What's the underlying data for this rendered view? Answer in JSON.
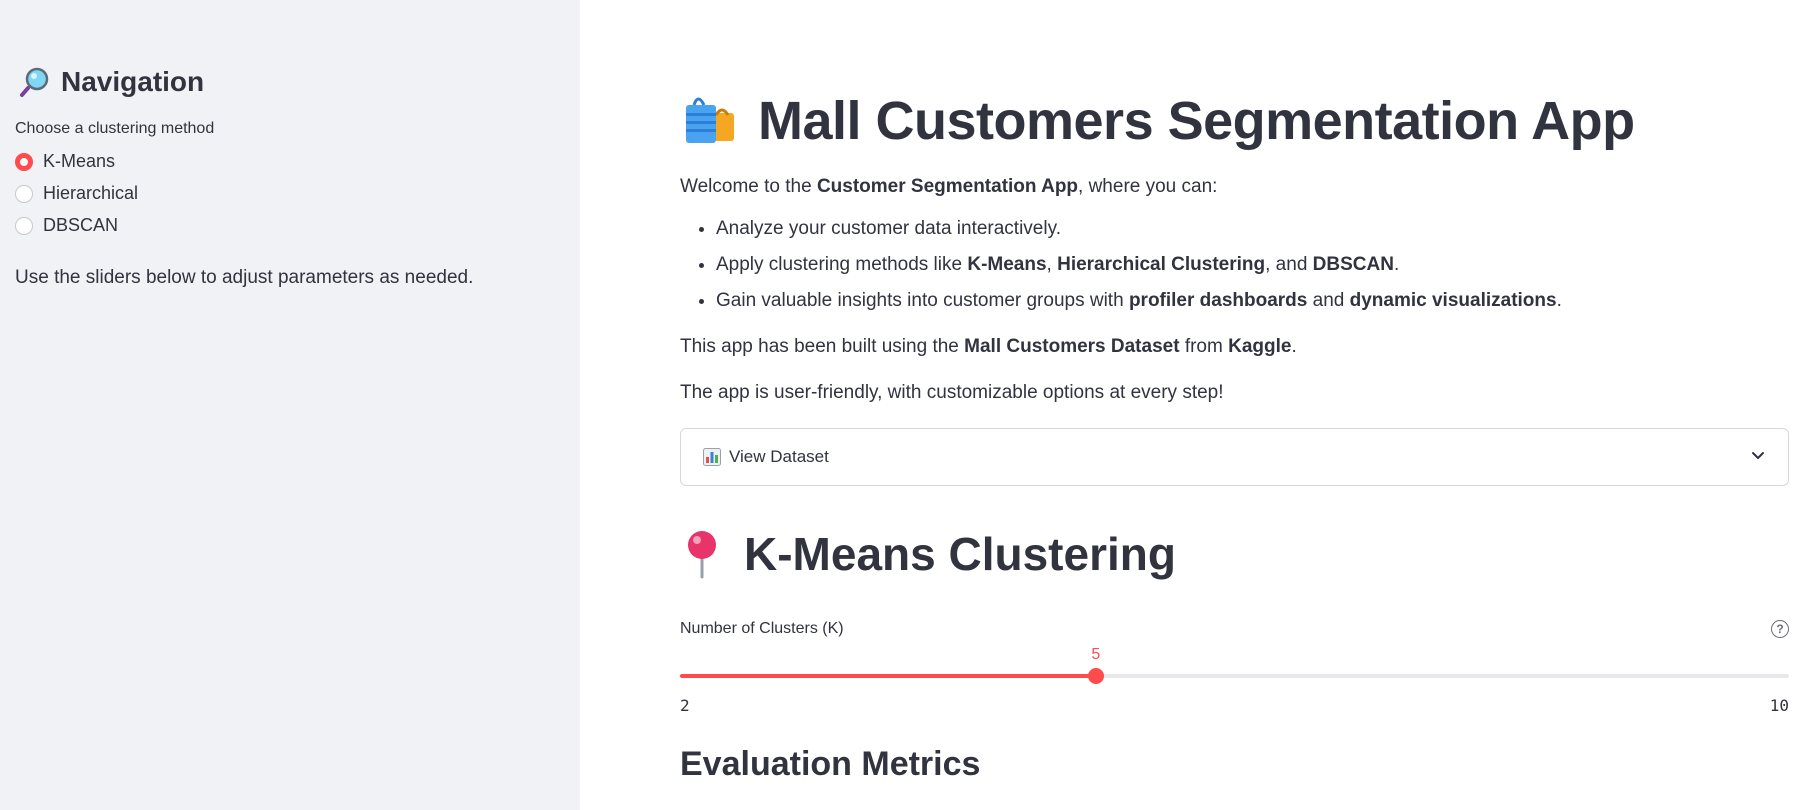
{
  "sidebar": {
    "title": "Navigation",
    "title_icon": "magnifier-icon",
    "radio_label": "Choose a clustering method",
    "options": [
      {
        "label": "K-Means",
        "selected": true
      },
      {
        "label": "Hierarchical",
        "selected": false
      },
      {
        "label": "DBSCAN",
        "selected": false
      }
    ],
    "note": "Use the sliders below to adjust parameters as needed."
  },
  "main": {
    "title": "Mall Customers Segmentation App",
    "title_icon": "shopping-bags-icon",
    "welcome_pre": "Welcome to the ",
    "welcome_bold": "Customer Segmentation App",
    "welcome_post": ", where you can:",
    "bullets": {
      "b1": "Analyze your customer data interactively.",
      "b2_pre": "Apply clustering methods like ",
      "b2_kmeans": "K-Means",
      "b2_sep1": ", ",
      "b2_hier": "Hierarchical Clustering",
      "b2_sep2": ", and ",
      "b2_dbscan": "DBSCAN",
      "b2_end": ".",
      "b3_pre": "Gain valuable insights into customer groups with ",
      "b3_prof": "profiler dashboards",
      "b3_mid": " and ",
      "b3_dyn": "dynamic visualizations",
      "b3_end": "."
    },
    "built_pre": "This app has been built using the ",
    "built_dataset": "Mall Customers Dataset",
    "built_mid": " from ",
    "built_kaggle": "Kaggle",
    "built_end": ".",
    "friendly": "The app is user-friendly, with customizable options at every step!",
    "expander_label": "View Dataset",
    "expander_icon": "bar-chart-icon",
    "section_title": "K-Means Clustering",
    "section_icon": "pushpin-icon",
    "slider": {
      "label": "Number of Clusters (K)",
      "min": 2,
      "max": 10,
      "value": 5,
      "min_label": "2",
      "max_label": "10",
      "value_label": "5",
      "accent": "#ff4b4b"
    },
    "eval_title": "Evaluation Metrics"
  }
}
